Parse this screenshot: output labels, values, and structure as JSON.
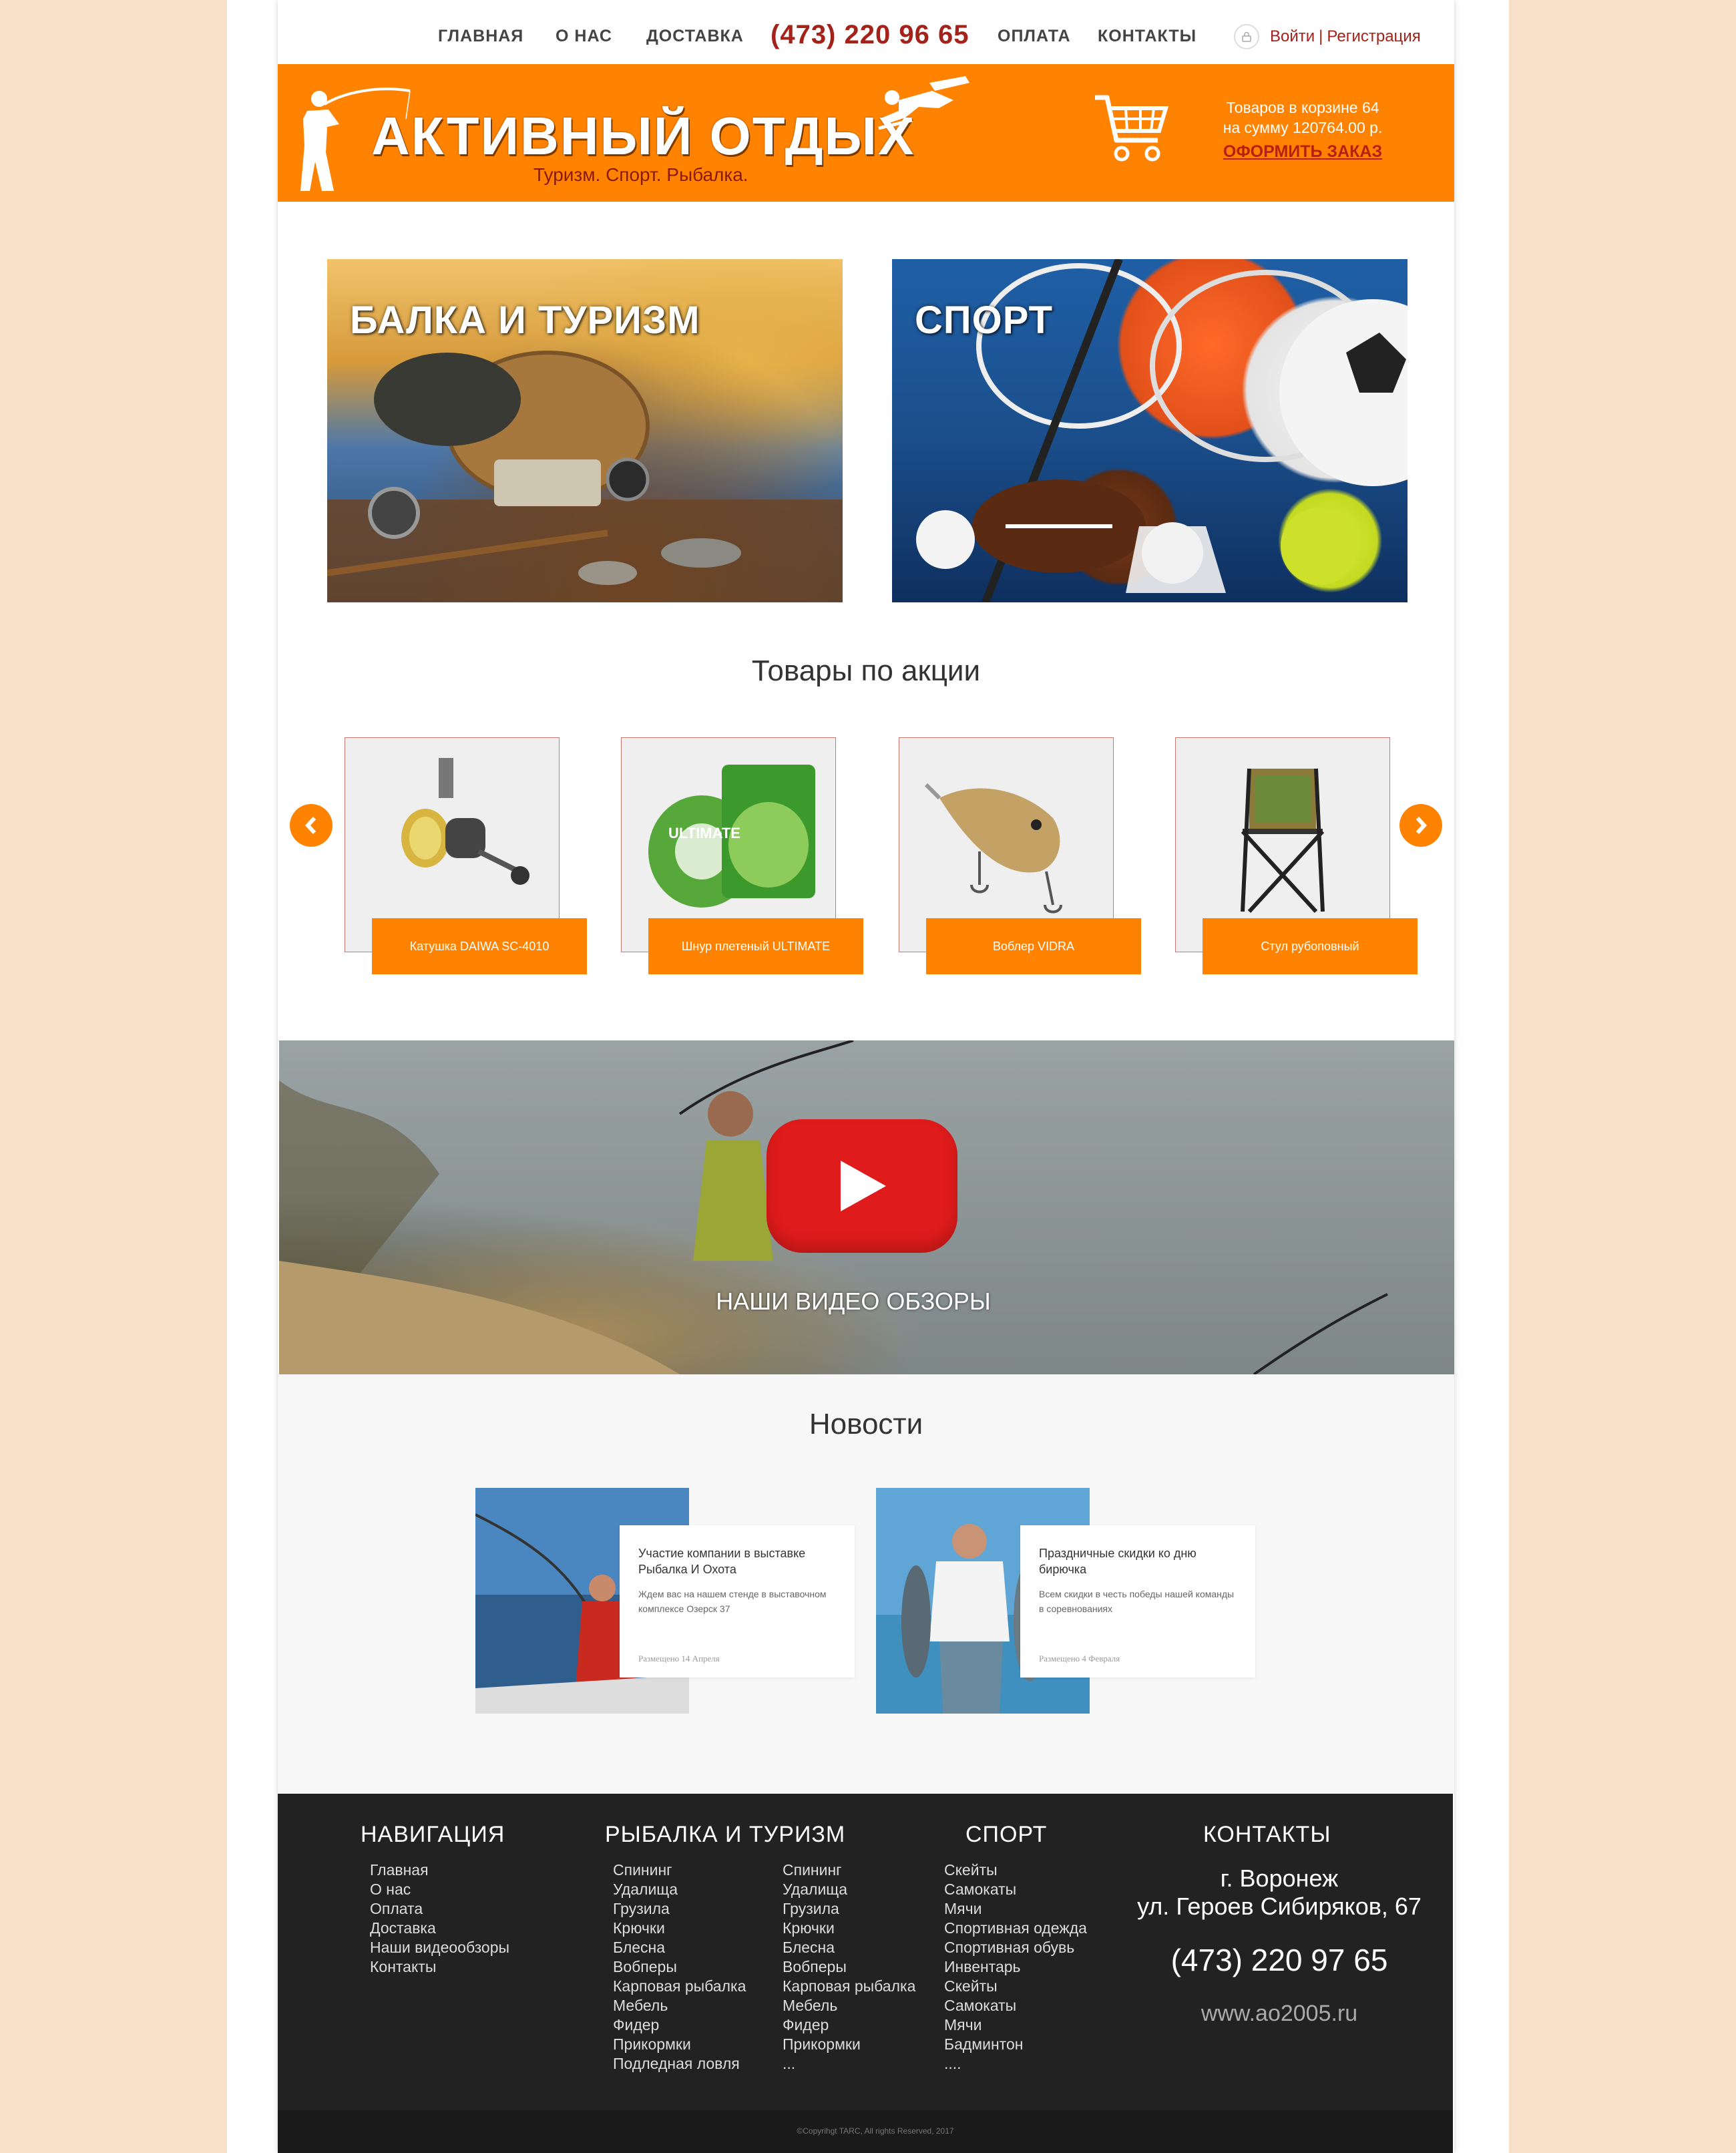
{
  "nav": {
    "items": [
      "ГЛАВНАЯ",
      "О НАС",
      "ДОСТАВКА",
      "ОПЛАТА",
      "КОНТАКТЫ"
    ],
    "phone": "(473) 220 96 65",
    "login": "Войти",
    "separator": "|",
    "register": "Регистрация"
  },
  "header": {
    "logo_title": "АКТИВНЫЙ ОТДЫХ",
    "tagline": "Туризм. Спорт. Рыбалка.",
    "cart_line1": "Товаров в корзине 64",
    "cart_line2": "на сумму  120764.00 р.",
    "order_link": "ОФОРМИТЬ ЗАКАЗ"
  },
  "banners": [
    {
      "label": "БАЛКА И ТУРИЗМ"
    },
    {
      "label": "СПОРТ"
    }
  ],
  "promo": {
    "title": "Товары по акции",
    "products": [
      {
        "name": "Катушка DAIWA SC-4010",
        "icon": "reel-icon"
      },
      {
        "name": "Шнур плетеный ULTIMATE",
        "icon": "line-spool-icon"
      },
      {
        "name": "Воблер VIDRA",
        "icon": "wobbler-icon"
      },
      {
        "name": "Стул рубоповный",
        "icon": "folding-chair-icon"
      }
    ],
    "prev_icon": "chevron-left-icon",
    "next_icon": "chevron-right-icon"
  },
  "video": {
    "label": "НАШИ ВИДЕО ОБЗОРЫ",
    "icon": "youtube-play-icon"
  },
  "news": {
    "title": "Новости",
    "items": [
      {
        "title": "Участие компании в выставке Рыбалка И Охота",
        "text": "Ждем вас на нашем стенде в выставочном комплексе Озерск 37",
        "date": "Размещено 14 Апреля"
      },
      {
        "title": "Праздничные скидки ко дню бирючка",
        "text": "Всем скидки в честь победы нашей команды в соревнованиях",
        "date": "Размещено 4 Февраля"
      }
    ]
  },
  "footer": {
    "nav_title": "НАВИГАЦИЯ",
    "nav_links": [
      "Главная",
      "О нас",
      "Оплата",
      "Доставка",
      "Наши видеообзоры",
      "Контакты"
    ],
    "fishing_title": "РЫБАЛКА И ТУРИЗМ",
    "fishing_col1": [
      "Спининг",
      "Удалища",
      "Грузила",
      "Крючки",
      "Блесна",
      "Вобперы",
      "Карповая рыбалка",
      "Мебель",
      "Фидер",
      "Прикормки",
      "Подледная ловля"
    ],
    "fishing_col2": [
      "Спининг",
      "Удалища",
      "Грузила",
      "Крючки",
      "Блесна",
      "Вобперы",
      "Карповая рыбалка",
      "Мебель",
      "Фидер",
      "Прикормки",
      "..."
    ],
    "sport_title": "СПОРТ",
    "sport_links": [
      "Скейты",
      "Самокаты",
      "Мячи",
      "Спортивная одежда",
      "Спортивная обувь",
      "Инвентарь",
      "Скейты",
      "Самокаты",
      "Мячи",
      "Бадминтон",
      "...."
    ],
    "contacts_title": "КОНТАКТЫ",
    "city": "г. Воронеж",
    "address": "ул. Героев Сибиряков, 67",
    "phone": "(473) 220 97 65",
    "website": "www.ao2005.ru",
    "copyright": "©Copyrihgt TARC, All rights Reserved, 2017"
  },
  "colors": {
    "accent": "#ff8300",
    "brand_red": "#a3221a",
    "footer_bg": "#222222",
    "page_bg": "#f8dfc9"
  }
}
